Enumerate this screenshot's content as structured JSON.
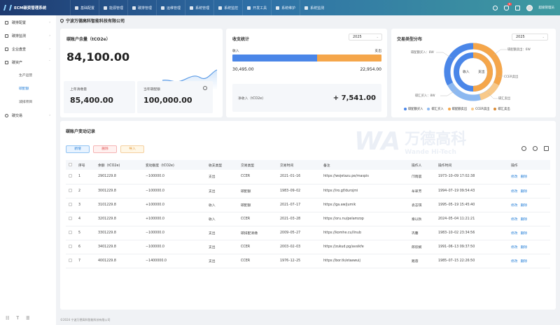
{
  "app": {
    "title": "ECM碳资管理系统"
  },
  "nav": [
    {
      "label": "基础配置"
    },
    {
      "label": "能源管理"
    },
    {
      "label": "碳排管理"
    },
    {
      "label": "运维管理"
    },
    {
      "label": "系统管理"
    },
    {
      "label": "系统监控"
    },
    {
      "label": "开发工具"
    },
    {
      "label": "系统维护"
    },
    {
      "label": "系统监测"
    }
  ],
  "topbar": {
    "notify_count": "5",
    "username": "超级管理员"
  },
  "sidebar": {
    "items": [
      {
        "label": "碳排配置"
      },
      {
        "label": "碳排监测"
      },
      {
        "label": "企业盘查"
      },
      {
        "label": "碳资产"
      }
    ],
    "subitems": [
      {
        "label": "生产运营"
      },
      {
        "label": "碳配额"
      },
      {
        "label": "减排项目"
      }
    ],
    "last_item": {
      "label": "碳交易"
    }
  },
  "breadcrumb": {
    "company": "宁波万德高科智能科技有限公司"
  },
  "balance_card": {
    "title": "碳账户余量（tCO2e）",
    "value": "84,100.00",
    "last_year_label": "上年清缴量",
    "last_year_value": "85,400.00",
    "current_label": "当年碳配额",
    "current_value": "100,000.00"
  },
  "flow_card": {
    "title": "收支统计",
    "year": "2025",
    "income_label": "收入",
    "expense_label": "支出",
    "income_value": "30,495.00",
    "expense_value": "22,954.00",
    "income_share": 0.57,
    "net_label": "净收入（tCO2e)",
    "net_value": "+ 7,541.00"
  },
  "type_card": {
    "title": "交易类型分布",
    "year": "2025",
    "inner_left": "收入",
    "inner_right": "支出",
    "callouts": [
      {
        "text": "碳配额买入：8W"
      },
      {
        "text": "碳配额卖出：6W"
      },
      {
        "text": "CCER卖出"
      },
      {
        "text": "碳汇买入：8W"
      },
      {
        "text": "碳汇卖出"
      }
    ],
    "legend": [
      {
        "label": "碳配额买入",
        "color": "#4a86e8"
      },
      {
        "label": "碳汇买入",
        "color": "#8cb8f0"
      },
      {
        "label": "碳配额卖出",
        "color": "#f5a64a"
      },
      {
        "label": "CCER卖出",
        "color": "#f8c98a"
      },
      {
        "label": "碳汇卖出",
        "color": "#d98a35"
      }
    ]
  },
  "records": {
    "title": "碳账户变动记录",
    "buttons": {
      "add": "新增",
      "delete": "删除",
      "import": "导入"
    },
    "watermark": {
      "cn": "万德高科",
      "en": "Wande Hi-Tech"
    },
    "columns": [
      "序号",
      "余额（tCO2e)",
      "变动额度（tCO2e)",
      "收支类型",
      "交易类型",
      "交易时间",
      "备注",
      "操作人",
      "操作时间",
      "操作"
    ],
    "actions": {
      "edit": "修改",
      "delete": "删除"
    },
    "rows": [
      {
        "no": "1",
        "balance": "2901229.8",
        "change": "−100000.0",
        "kind": "支出",
        "type": "CCER",
        "date": "2021–01–16",
        "note": "https://wojetazu.pe/maspis",
        "op": "邝雨晨",
        "time": "1973–10–09 17:02:38"
      },
      {
        "no": "2",
        "balance": "3001229.8",
        "change": "−100000.0",
        "kind": "支出",
        "type": "碳配额",
        "date": "1983–09–02",
        "note": "https://iro.gf/durojmi",
        "op": "牟翠芳",
        "time": "1994–07–19 09:54:43"
      },
      {
        "no": "3",
        "balance": "3101229.8",
        "change": "+100000.0",
        "kind": "收入",
        "type": "碳配额",
        "date": "2021–07–17",
        "note": "https://ga.aw/jumik",
        "op": "袁志琪",
        "time": "1995–05–19 15:45:40"
      },
      {
        "no": "4",
        "balance": "3201229.8",
        "change": "+100000.0",
        "kind": "收入",
        "type": "CCER",
        "date": "2021–03–28",
        "note": "https://oru.nu/pelamzop",
        "op": "秦以秋",
        "time": "2024–05–04 11:21:21"
      },
      {
        "no": "5",
        "balance": "3301229.8",
        "change": "−100000.0",
        "kind": "支出",
        "type": "碳排配清缴",
        "date": "2009–05–27",
        "note": "https://komhe.cu/linub",
        "op": "巩馨",
        "time": "1983–10–02 23:34:56"
      },
      {
        "no": "6",
        "balance": "3401229.8",
        "change": "−100000.0",
        "kind": "支出",
        "type": "CCER",
        "date": "2003–02–03",
        "note": "https://zukud.pg/avsikfe",
        "op": "郎欣娴",
        "time": "1991–06–13 09:37:50"
      },
      {
        "no": "7",
        "balance": "4001229.8",
        "change": "−1400000.0",
        "kind": "支出",
        "type": "CCER",
        "date": "1976–12–25",
        "note": "https://bor.tk/etaawuij",
        "op": "路蓉",
        "time": "1985–07–15 22:26:50"
      }
    ]
  },
  "footer": {
    "text": "©2024 宁波万德高科智能科技有限公司"
  }
}
